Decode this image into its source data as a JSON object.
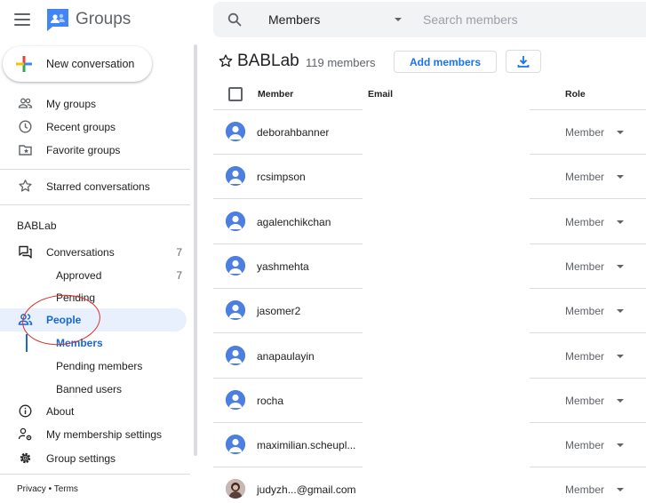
{
  "header": {
    "app_title": "Groups",
    "search_scope": "Members",
    "search_placeholder": "Search members"
  },
  "sidebar": {
    "new_conversation": "New conversation",
    "nav_top": [
      {
        "label": "My groups",
        "icon": "people-icon"
      },
      {
        "label": "Recent groups",
        "icon": "clock-icon"
      },
      {
        "label": "Favorite groups",
        "icon": "folder-star-icon"
      }
    ],
    "starred": "Starred conversations",
    "section_title": "BABLab",
    "conversations": {
      "label": "Conversations",
      "count": "7"
    },
    "approved": {
      "label": "Approved",
      "count": "7"
    },
    "pending": "Pending",
    "people": "People",
    "members": "Members",
    "pending_members": "Pending members",
    "banned_users": "Banned users",
    "about": "About",
    "membership_settings": "My membership settings",
    "group_settings": "Group settings",
    "footer": {
      "privacy": "Privacy",
      "separator": " • ",
      "terms": "Terms"
    }
  },
  "main": {
    "group_name": "BABLab",
    "member_count": "119 members",
    "add_members": "Add members",
    "columns": {
      "member": "Member",
      "email": "Email",
      "role": "Role"
    },
    "members": [
      {
        "name": "deborahbanner",
        "role": "Member"
      },
      {
        "name": "rcsimpson",
        "role": "Member"
      },
      {
        "name": "agalenchikchan",
        "role": "Member"
      },
      {
        "name": "yashmehta",
        "role": "Member"
      },
      {
        "name": "jasomer2",
        "role": "Member"
      },
      {
        "name": "anapaulayin",
        "role": "Member"
      },
      {
        "name": "rocha",
        "role": "Member"
      },
      {
        "name": "maximilian.scheupl...",
        "role": "Member"
      },
      {
        "name": "judyzh...@gmail.com",
        "role": "Member"
      }
    ]
  },
  "colors": {
    "accent": "#1a73e8",
    "active_bg": "#e8f0fe",
    "annotation": "#d93025",
    "avatar": "#4d7fe0"
  }
}
